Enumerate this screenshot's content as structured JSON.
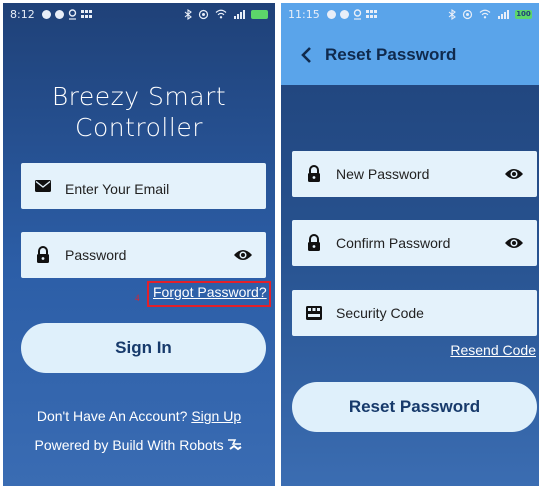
{
  "left_screen": {
    "status_bar": {
      "time": "8:12"
    },
    "app_title_line1": "Breezy Smart",
    "app_title_line2": "Controller",
    "email_field": {
      "placeholder": "Enter Your Email",
      "icon": "mail-icon"
    },
    "password_field": {
      "placeholder": "Password",
      "icon": "lock-icon",
      "toggle_icon": "eye-icon"
    },
    "forgot_password": "Forgot Password?",
    "annotation_mark": "4",
    "sign_in_button": "Sign In",
    "no_account_text": "Don't Have An Account?",
    "sign_up_link": "Sign Up",
    "powered_by": "Powered by Build With Robots",
    "colors": {
      "background_top": "#1f4178",
      "background_bottom": "#3a6cb3",
      "field_bg": "#e4f2fb",
      "button_bg": "#dff0fb",
      "highlight": "#e3202a"
    }
  },
  "right_screen": {
    "status_bar": {
      "time": "11:15",
      "battery": "100"
    },
    "appbar": {
      "title": "Reset Password",
      "back_icon": "back-chevron-icon"
    },
    "new_password_field": {
      "placeholder": "New Password",
      "icon": "lock-icon",
      "toggle_icon": "eye-icon"
    },
    "confirm_password_field": {
      "placeholder": "Confirm Password",
      "icon": "lock-icon",
      "toggle_icon": "eye-icon"
    },
    "security_code_field": {
      "placeholder": "Security Code",
      "icon": "keypad-icon"
    },
    "resend_code": "Resend Code",
    "reset_button": "Reset Password",
    "colors": {
      "appbar": "#5aa4ea",
      "title_text": "#102a4d"
    }
  }
}
